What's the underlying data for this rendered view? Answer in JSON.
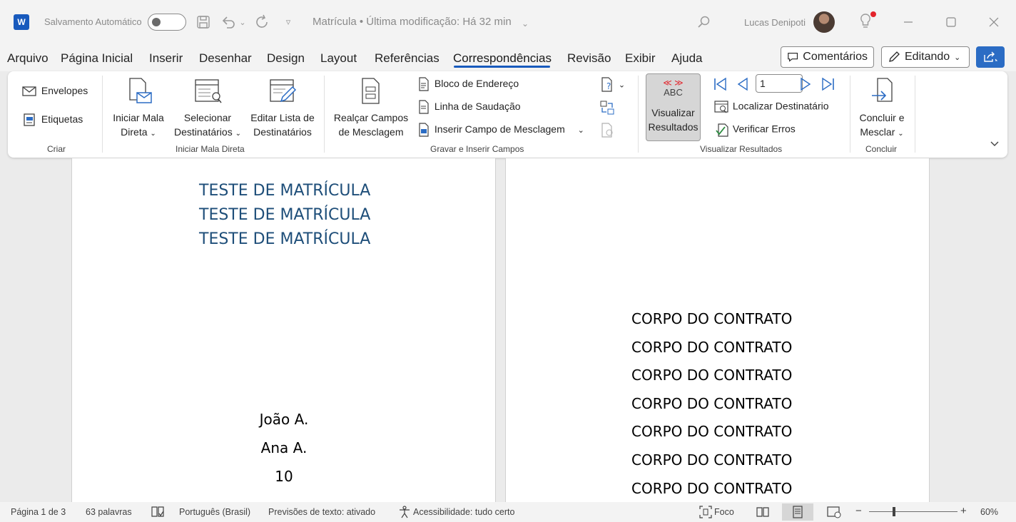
{
  "titlebar": {
    "autosave_label": "Salvamento Automático",
    "doc_title": "Matrícula • Última modificação: Há 32 min",
    "user_name": "Lucas Denipoti"
  },
  "menu": {
    "items": [
      "Arquivo",
      "Página Inicial",
      "Inserir",
      "Desenhar",
      "Design",
      "Layout",
      "Referências",
      "Correspondências",
      "Revisão",
      "Exibir",
      "Ajuda"
    ],
    "active": "Correspondências",
    "comments_label": "Comentários",
    "editing_label": "Editando"
  },
  "ribbon": {
    "criar": {
      "envelopes": "Envelopes",
      "etiquetas": "Etiquetas",
      "group": "Criar"
    },
    "iniciar": {
      "iniciar_l1": "Iniciar Mala",
      "iniciar_l2": "Direta",
      "selecionar_l1": "Selecionar",
      "selecionar_l2": "Destinatários",
      "editar_l1": "Editar Lista de",
      "editar_l2": "Destinatários",
      "group": "Iniciar Mala Direta"
    },
    "gravar": {
      "realcar_l1": "Realçar Campos",
      "realcar_l2": "de Mesclagem",
      "bloco": "Bloco de Endereço",
      "linha": "Linha de Saudação",
      "inserir": "Inserir Campo de Mesclagem",
      "group": "Gravar e Inserir Campos"
    },
    "visualizar": {
      "abc": "ABC",
      "vis_l1": "Visualizar",
      "vis_l2": "Resultados",
      "record": "1",
      "localizar": "Localizar Destinatário",
      "verificar": "Verificar Erros",
      "group": "Visualizar Resultados"
    },
    "concluir": {
      "l1": "Concluir e",
      "l2": "Mesclar",
      "group": "Concluir"
    }
  },
  "document": {
    "left_titles": [
      "TESTE DE MATRÍCULA",
      "TESTE DE MATRÍCULA",
      "TESTE DE MATRÍCULA"
    ],
    "left_fields": [
      "João A.",
      "Ana A.",
      "10"
    ],
    "right_lines": [
      "CORPO DO CONTRATO",
      "CORPO DO CONTRATO",
      "CORPO DO CONTRATO",
      "CORPO DO CONTRATO",
      "CORPO DO CONTRATO",
      "CORPO DO CONTRATO",
      "CORPO DO CONTRATO"
    ]
  },
  "status": {
    "page": "Página 1 de 3",
    "words": "63 palavras",
    "language": "Português (Brasil)",
    "predictions": "Previsões de texto: ativado",
    "accessibility": "Acessibilidade: tudo certo",
    "focus": "Foco",
    "zoom": "60%"
  }
}
